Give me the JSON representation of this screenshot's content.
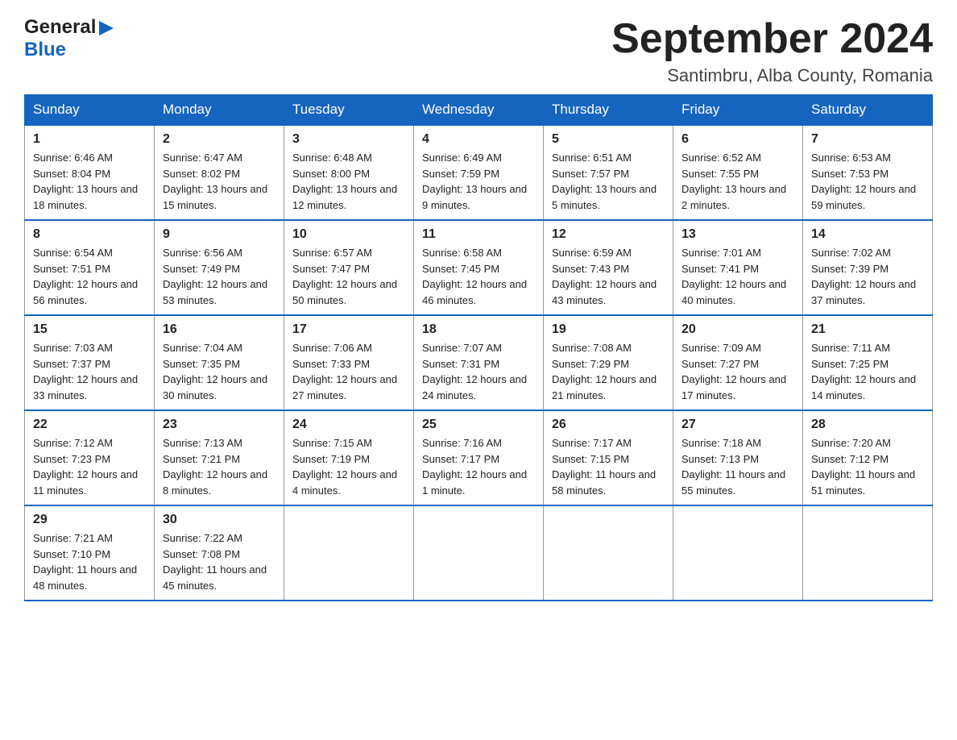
{
  "header": {
    "logo_general": "General",
    "logo_blue": "Blue",
    "month_title": "September 2024",
    "location": "Santimbru, Alba County, Romania"
  },
  "weekdays": [
    "Sunday",
    "Monday",
    "Tuesday",
    "Wednesday",
    "Thursday",
    "Friday",
    "Saturday"
  ],
  "weeks": [
    [
      {
        "day": "1",
        "sunrise": "6:46 AM",
        "sunset": "8:04 PM",
        "daylight": "13 hours and 18 minutes."
      },
      {
        "day": "2",
        "sunrise": "6:47 AM",
        "sunset": "8:02 PM",
        "daylight": "13 hours and 15 minutes."
      },
      {
        "day": "3",
        "sunrise": "6:48 AM",
        "sunset": "8:00 PM",
        "daylight": "13 hours and 12 minutes."
      },
      {
        "day": "4",
        "sunrise": "6:49 AM",
        "sunset": "7:59 PM",
        "daylight": "13 hours and 9 minutes."
      },
      {
        "day": "5",
        "sunrise": "6:51 AM",
        "sunset": "7:57 PM",
        "daylight": "13 hours and 5 minutes."
      },
      {
        "day": "6",
        "sunrise": "6:52 AM",
        "sunset": "7:55 PM",
        "daylight": "13 hours and 2 minutes."
      },
      {
        "day": "7",
        "sunrise": "6:53 AM",
        "sunset": "7:53 PM",
        "daylight": "12 hours and 59 minutes."
      }
    ],
    [
      {
        "day": "8",
        "sunrise": "6:54 AM",
        "sunset": "7:51 PM",
        "daylight": "12 hours and 56 minutes."
      },
      {
        "day": "9",
        "sunrise": "6:56 AM",
        "sunset": "7:49 PM",
        "daylight": "12 hours and 53 minutes."
      },
      {
        "day": "10",
        "sunrise": "6:57 AM",
        "sunset": "7:47 PM",
        "daylight": "12 hours and 50 minutes."
      },
      {
        "day": "11",
        "sunrise": "6:58 AM",
        "sunset": "7:45 PM",
        "daylight": "12 hours and 46 minutes."
      },
      {
        "day": "12",
        "sunrise": "6:59 AM",
        "sunset": "7:43 PM",
        "daylight": "12 hours and 43 minutes."
      },
      {
        "day": "13",
        "sunrise": "7:01 AM",
        "sunset": "7:41 PM",
        "daylight": "12 hours and 40 minutes."
      },
      {
        "day": "14",
        "sunrise": "7:02 AM",
        "sunset": "7:39 PM",
        "daylight": "12 hours and 37 minutes."
      }
    ],
    [
      {
        "day": "15",
        "sunrise": "7:03 AM",
        "sunset": "7:37 PM",
        "daylight": "12 hours and 33 minutes."
      },
      {
        "day": "16",
        "sunrise": "7:04 AM",
        "sunset": "7:35 PM",
        "daylight": "12 hours and 30 minutes."
      },
      {
        "day": "17",
        "sunrise": "7:06 AM",
        "sunset": "7:33 PM",
        "daylight": "12 hours and 27 minutes."
      },
      {
        "day": "18",
        "sunrise": "7:07 AM",
        "sunset": "7:31 PM",
        "daylight": "12 hours and 24 minutes."
      },
      {
        "day": "19",
        "sunrise": "7:08 AM",
        "sunset": "7:29 PM",
        "daylight": "12 hours and 21 minutes."
      },
      {
        "day": "20",
        "sunrise": "7:09 AM",
        "sunset": "7:27 PM",
        "daylight": "12 hours and 17 minutes."
      },
      {
        "day": "21",
        "sunrise": "7:11 AM",
        "sunset": "7:25 PM",
        "daylight": "12 hours and 14 minutes."
      }
    ],
    [
      {
        "day": "22",
        "sunrise": "7:12 AM",
        "sunset": "7:23 PM",
        "daylight": "12 hours and 11 minutes."
      },
      {
        "day": "23",
        "sunrise": "7:13 AM",
        "sunset": "7:21 PM",
        "daylight": "12 hours and 8 minutes."
      },
      {
        "day": "24",
        "sunrise": "7:15 AM",
        "sunset": "7:19 PM",
        "daylight": "12 hours and 4 minutes."
      },
      {
        "day": "25",
        "sunrise": "7:16 AM",
        "sunset": "7:17 PM",
        "daylight": "12 hours and 1 minute."
      },
      {
        "day": "26",
        "sunrise": "7:17 AM",
        "sunset": "7:15 PM",
        "daylight": "11 hours and 58 minutes."
      },
      {
        "day": "27",
        "sunrise": "7:18 AM",
        "sunset": "7:13 PM",
        "daylight": "11 hours and 55 minutes."
      },
      {
        "day": "28",
        "sunrise": "7:20 AM",
        "sunset": "7:12 PM",
        "daylight": "11 hours and 51 minutes."
      }
    ],
    [
      {
        "day": "29",
        "sunrise": "7:21 AM",
        "sunset": "7:10 PM",
        "daylight": "11 hours and 48 minutes."
      },
      {
        "day": "30",
        "sunrise": "7:22 AM",
        "sunset": "7:08 PM",
        "daylight": "11 hours and 45 minutes."
      },
      null,
      null,
      null,
      null,
      null
    ]
  ]
}
